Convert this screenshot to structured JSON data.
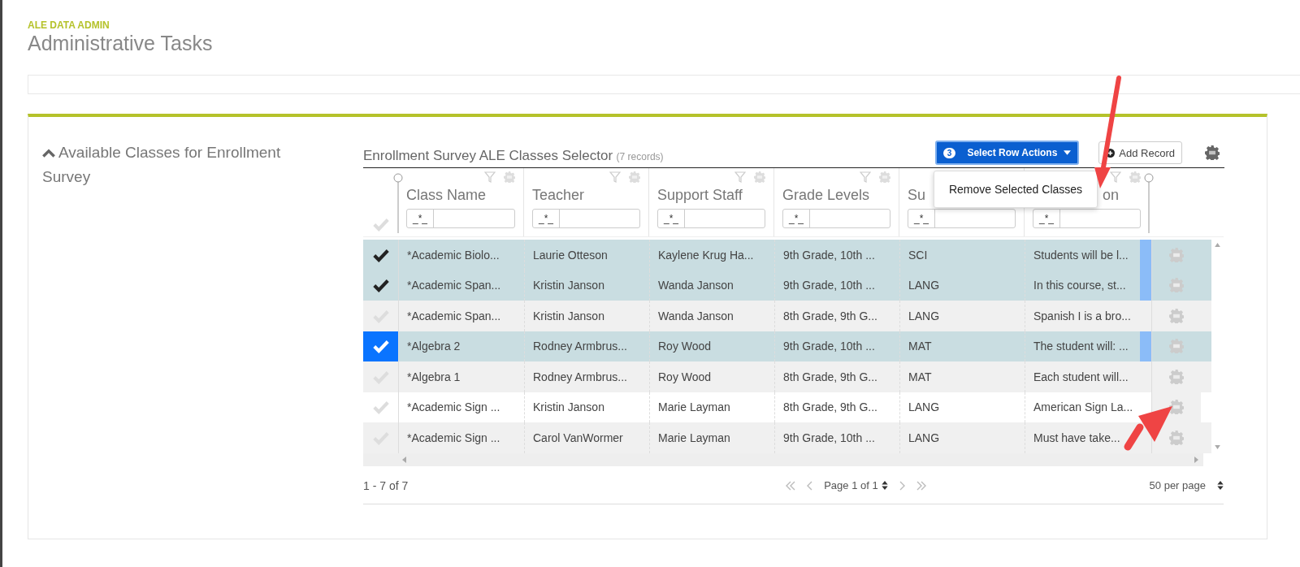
{
  "header": {
    "eyebrow": "ALE DATA ADMIN",
    "title": "Administrative Tasks"
  },
  "section": {
    "title": "Available Classes for Enrollment Survey",
    "expanded": true
  },
  "grid": {
    "title": "Enrollment Survey ALE Classes Selector",
    "record_count": "(7 records)",
    "row_actions": {
      "count": "3",
      "label": "Select Row Actions"
    },
    "add_button": "Add Record",
    "menu": {
      "items": [
        "Remove Selected Classes"
      ]
    },
    "all_selected": false,
    "columns": [
      {
        "name": "Class Name",
        "filter_mode": "_*_",
        "icons_visible": true
      },
      {
        "name": "Teacher",
        "filter_mode": "_*_",
        "icons_visible": true
      },
      {
        "name": "Support Staff",
        "filter_mode": "_*_",
        "icons_visible": true
      },
      {
        "name": "Grade Levels",
        "filter_mode": "_*_",
        "icons_visible": true
      },
      {
        "name": "Su",
        "filter_mode": "_*_",
        "icons_visible": false
      },
      {
        "name": "on",
        "filter_mode": "_*_",
        "icons_visible": true
      }
    ],
    "rows": [
      {
        "cells": [
          "*Academic Biolo...",
          "Laurie Otteson",
          "Kaylene Krug Ha...",
          "9th Grade, 10th ...",
          "SCI",
          "Students will be l..."
        ],
        "selected": true,
        "focused": false
      },
      {
        "cells": [
          "*Academic Span...",
          "Kristin Janson",
          "Wanda Janson",
          "9th Grade, 10th ...",
          "LANG",
          "In this course, st..."
        ],
        "selected": true,
        "focused": false
      },
      {
        "cells": [
          "*Academic Span...",
          "Kristin Janson",
          "Wanda Janson",
          "8th Grade, 9th G...",
          "LANG",
          "Spanish I is a bro..."
        ],
        "selected": false,
        "focused": false
      },
      {
        "cells": [
          "*Algebra 2",
          "Rodney Armbrus...",
          "Roy Wood",
          "9th Grade, 10th ...",
          "MAT",
          "The student will: ..."
        ],
        "selected": true,
        "focused": true
      },
      {
        "cells": [
          "*Algebra 1",
          "Rodney Armbrus...",
          "Roy Wood",
          "8th Grade, 9th G...",
          "MAT",
          "Each student will..."
        ],
        "selected": false,
        "focused": false
      },
      {
        "cells": [
          "*Academic Sign ...",
          "Kristin Janson",
          "Marie Layman",
          "8th Grade, 9th G...",
          "LANG",
          "American Sign La..."
        ],
        "selected": false,
        "focused": false
      },
      {
        "cells": [
          "*Academic Sign ...",
          "Carol VanWormer",
          "Marie Layman",
          "9th Grade, 10th ...",
          "LANG",
          "Must have take..."
        ],
        "selected": false,
        "focused": false
      }
    ],
    "footer": {
      "range": "1 - 7 of 7",
      "page": "Page 1 of 1",
      "per_page": "50 per page"
    }
  }
}
